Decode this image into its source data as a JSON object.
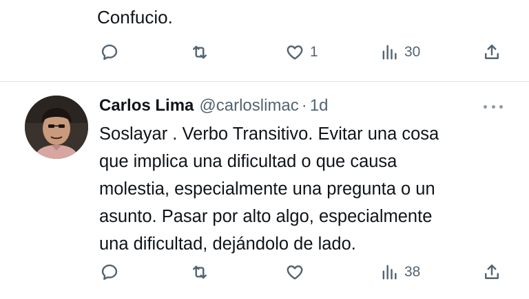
{
  "previous_tweet": {
    "text_tail": "Confucio.",
    "actions": {
      "reply_count": "",
      "retweet_count": "",
      "like_count": "1",
      "view_count": "30"
    }
  },
  "tweet": {
    "author": {
      "display_name": "Carlos Lima",
      "handle": "@carloslimac",
      "separator": "·",
      "time": "1d"
    },
    "text": "Soslayar . Verbo Transitivo.  Evitar una cosa\nque implica una dificultad o que causa\nmolestia, especialmente una pregunta o un\nasunto.  Pasar por alto algo, especialmente\nuna dificultad, dejándolo de lado.",
    "actions": {
      "reply_count": "",
      "retweet_count": "",
      "like_count": "",
      "view_count": "38"
    }
  },
  "icons": {
    "reply": "reply-icon",
    "retweet": "retweet-icon",
    "like": "heart-icon",
    "views": "views-icon",
    "share": "share-icon",
    "more": "more-icon"
  },
  "colors": {
    "text": "#0f1419",
    "muted": "#536471",
    "divider": "#dde3e8"
  }
}
